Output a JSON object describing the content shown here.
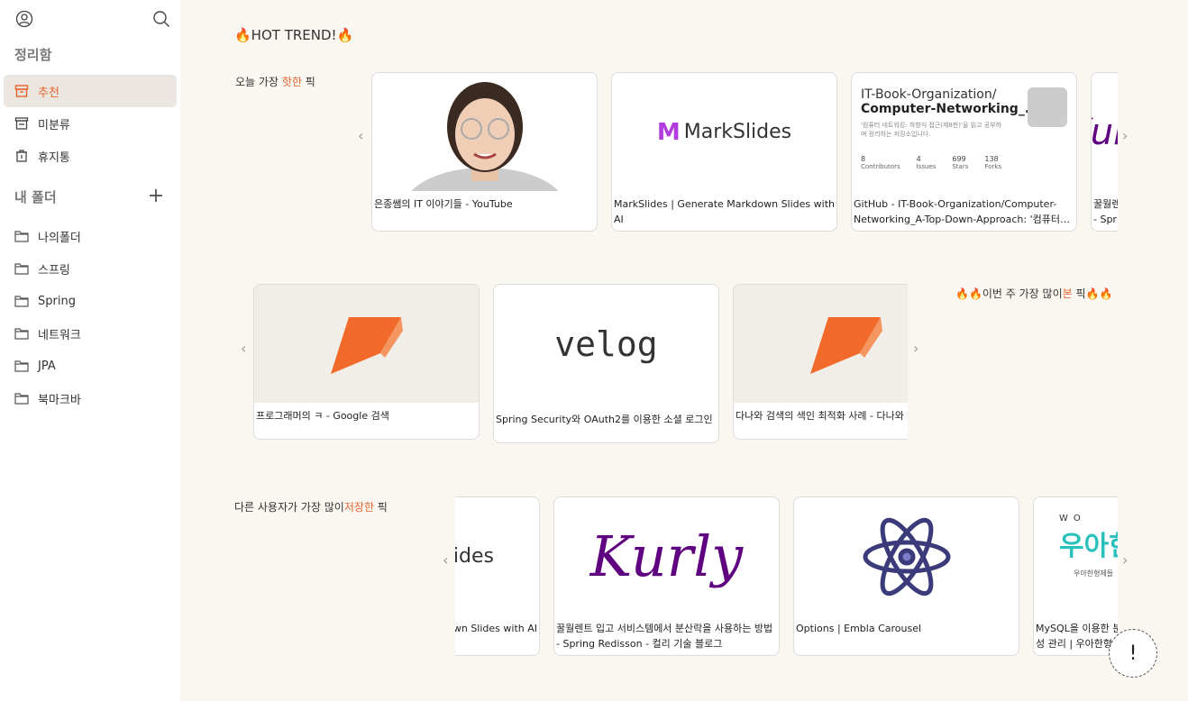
{
  "sidebar": {
    "section_title": "정리함",
    "items": [
      {
        "label": "추천",
        "icon": "archive-icon",
        "active": true
      },
      {
        "label": "미분류",
        "icon": "inbox-icon"
      },
      {
        "label": "휴지통",
        "icon": "trash-icon"
      }
    ],
    "folders_title": "내 폴더",
    "folders": [
      "나의폴더",
      "스프링",
      "Spring",
      "네트워크",
      "JPA",
      "북마크바"
    ]
  },
  "main": {
    "heading": "🔥HOT TREND!🔥",
    "row1": {
      "label_pre": "오늘 가장 ",
      "label_hl": "핫한",
      "label_post": " 픽",
      "cards": [
        "은종쌤의 IT 이야기들 - YouTube",
        "MarkSlides | Generate Markdown Slides with AI",
        "GitHub - IT-Book-Organization/Computer-Networking_A-Top-Down-Approach: '컴퓨터…",
        "꿀월렌트 입고 서비스템에서 분산락을 사용하는 방법 - Spring Redisson"
      ]
    },
    "github_preview": {
      "org": "IT-Book-Organization/",
      "repo": "Computer-Networking_...",
      "desc": "'컴퓨터 네트워킹: 하향식 접근(제8판)'을 읽고 공부하며 정리하는 저장소입니다.",
      "stats": [
        {
          "v": "8",
          "k": "Contributors"
        },
        {
          "v": "4",
          "k": "Issues"
        },
        {
          "v": "699",
          "k": "Stars"
        },
        {
          "v": "138",
          "k": "Forks"
        }
      ]
    },
    "markslides_logo": "MarkSlides",
    "row2": {
      "label_pre": "🔥🔥이번 주 가장 많이",
      "label_hl": "본",
      "label_post": " 픽🔥🔥",
      "cards": [
        "프로그래머의 ㅋ - Google 검색",
        "Spring Security와 OAuth2를 이용한 소셜 로그인",
        "다나와 검색의 색인 최적화 사례 - 다나와 블로그"
      ]
    },
    "velog_logo": "velog",
    "row3": {
      "label_pre": "다른 사용자가 가장 많이",
      "label_hl": "저장한",
      "label_post": " 픽",
      "cards": [
        "MarkSlides | Generate Markdown Slides with AI",
        "꿀월렌트 입고 서비스템에서 분산락을 사용하는 방법 - Spring Redisson - 컬리 기술 블로그",
        "Options | Embla Carousel",
        "MySQL을 이용한 분산락으로 여러 서버에 걸친 동시성 관리 | 우아한형제들 기술블로그"
      ]
    },
    "kurly_logo": "Kurly",
    "woowa_logo": "우아한",
    "woowa_sub": "우아한형제들",
    "woowa_top": "WO",
    "slides_fragment": "lides"
  },
  "colors": {
    "accent": "#e8622c",
    "bg": "#faf7f1"
  }
}
